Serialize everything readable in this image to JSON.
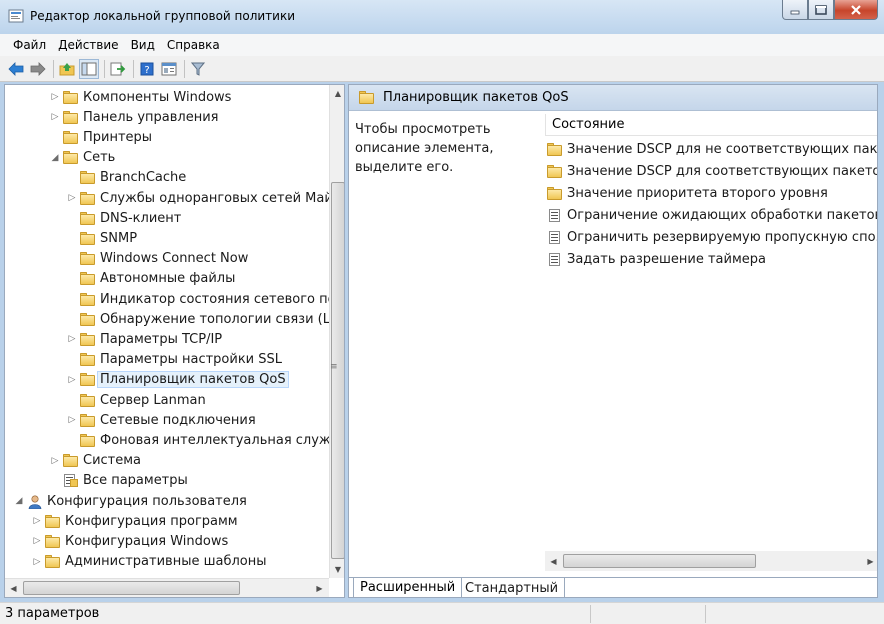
{
  "window": {
    "title": "Редактор локальной групповой политики"
  },
  "menu": [
    "Файл",
    "Действие",
    "Вид",
    "Справка"
  ],
  "toolbar": [
    "back-icon",
    "forward-icon",
    "up-folder-icon",
    "show-hide-tree-icon",
    "export-list-icon",
    "help-icon",
    "properties-icon",
    "filter-icon"
  ],
  "tree": {
    "items": [
      {
        "label": "Компоненты Windows",
        "level": 2,
        "arrow": "collapsed",
        "icon": "folder"
      },
      {
        "label": "Панель управления",
        "level": 2,
        "arrow": "collapsed",
        "icon": "folder"
      },
      {
        "label": "Принтеры",
        "level": 2,
        "arrow": "none",
        "icon": "folder"
      },
      {
        "label": "Сеть",
        "level": 2,
        "arrow": "expanded",
        "icon": "folder"
      },
      {
        "label": "BranchCache",
        "level": 3,
        "arrow": "none",
        "icon": "folder"
      },
      {
        "label": "Службы одноранговых сетей Майкр",
        "level": 3,
        "arrow": "collapsed",
        "icon": "folder"
      },
      {
        "label": "DNS-клиент",
        "level": 3,
        "arrow": "none",
        "icon": "folder"
      },
      {
        "label": "SNMP",
        "level": 3,
        "arrow": "none",
        "icon": "folder"
      },
      {
        "label": "Windows Connect Now",
        "level": 3,
        "arrow": "none",
        "icon": "folder"
      },
      {
        "label": "Автономные файлы",
        "level": 3,
        "arrow": "none",
        "icon": "folder"
      },
      {
        "label": "Индикатор состояния сетевого под",
        "level": 3,
        "arrow": "none",
        "icon": "folder"
      },
      {
        "label": "Обнаружение топологии связи (Lin",
        "level": 3,
        "arrow": "none",
        "icon": "folder"
      },
      {
        "label": "Параметры TCP/IP",
        "level": 3,
        "arrow": "collapsed",
        "icon": "folder"
      },
      {
        "label": "Параметры настройки SSL",
        "level": 3,
        "arrow": "none",
        "icon": "folder"
      },
      {
        "label": "Планировщик пакетов QoS",
        "level": 3,
        "arrow": "collapsed",
        "icon": "folder",
        "selected": true
      },
      {
        "label": "Сервер Lanman",
        "level": 3,
        "arrow": "none",
        "icon": "folder"
      },
      {
        "label": "Сетевые подключения",
        "level": 3,
        "arrow": "collapsed",
        "icon": "folder"
      },
      {
        "label": "Фоновая интеллектуальная служба",
        "level": 3,
        "arrow": "none",
        "icon": "folder"
      },
      {
        "label": "Система",
        "level": 2,
        "arrow": "collapsed",
        "icon": "folder"
      },
      {
        "label": "Все параметры",
        "level": 2,
        "arrow": "none",
        "icon": "settings"
      },
      {
        "label": "Конфигурация пользователя",
        "level": 0,
        "arrow": "expanded",
        "icon": "user"
      },
      {
        "label": "Конфигурация программ",
        "level": 1,
        "arrow": "collapsed",
        "icon": "folder"
      },
      {
        "label": "Конфигурация Windows",
        "level": 1,
        "arrow": "collapsed",
        "icon": "folder"
      },
      {
        "label": "Административные шаблоны",
        "level": 1,
        "arrow": "collapsed",
        "icon": "folder"
      }
    ]
  },
  "right": {
    "header": "Планировщик пакетов QoS",
    "description": "Чтобы просмотреть описание элемента, выделите его.",
    "column": "Состояние",
    "items": [
      {
        "label": "Значение DSCP для не соответствующих паке...",
        "icon": "folder"
      },
      {
        "label": "Значение DSCP для соответствующих пакетов",
        "icon": "folder"
      },
      {
        "label": "Значение приоритета второго уровня",
        "icon": "folder"
      },
      {
        "label": "Ограничение ожидающих обработки пакетов",
        "icon": "policy"
      },
      {
        "label": "Ограничить резервируемую пропускную спо...",
        "icon": "policy"
      },
      {
        "label": "Задать разрешение таймера",
        "icon": "policy"
      }
    ],
    "tabs": {
      "extended": "Расширенный",
      "standard": "Стандартный"
    }
  },
  "status": {
    "text": "3 параметров"
  }
}
